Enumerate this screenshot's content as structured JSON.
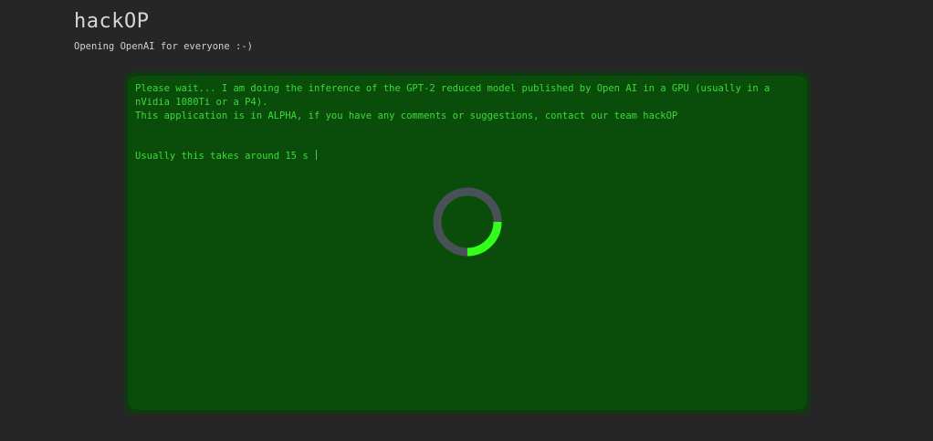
{
  "header": {
    "title": "hackOP",
    "subtitle": "Opening OpenAI for everyone :-)"
  },
  "terminal": {
    "message_line_1": "Please wait... I am doing the inference of the GPT-2 reduced model published by Open AI in a GPU (usually in a nVidia 1080Ti or a P4).",
    "message_line_2": "This application is in ALPHA, if you have any comments or suggestions, contact our team hackOP",
    "wait_text": "Usually this takes around 15 s"
  },
  "spinner": {
    "icon": "loading-spinner-icon",
    "progress_fraction": 0.25
  },
  "colors": {
    "page_background": "#262626",
    "terminal_background": "#0a4d0a",
    "terminal_text": "#3ed83e",
    "spinner_track": "#4a5058",
    "spinner_arc": "#33ff1a"
  }
}
